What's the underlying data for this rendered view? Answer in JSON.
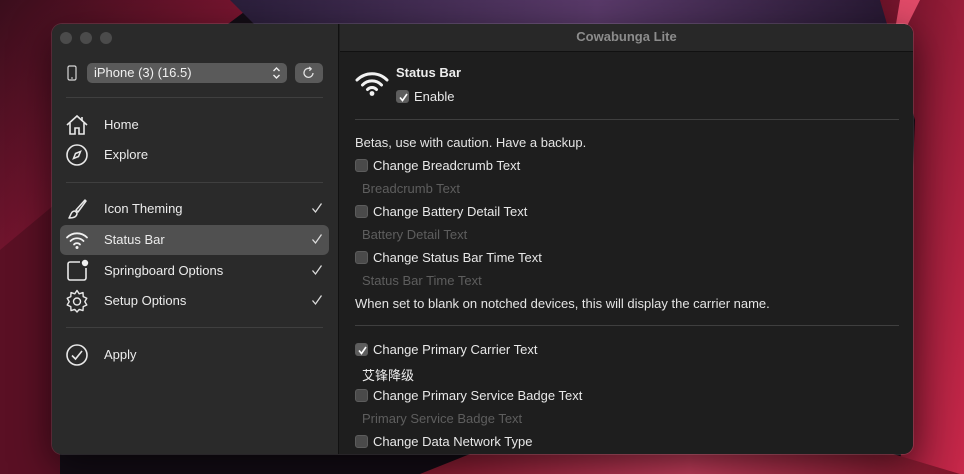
{
  "window": {
    "title": "Cowabunga Lite"
  },
  "sidebar": {
    "device_select": "iPhone (3) (16.5)",
    "items": [
      {
        "label": "Home",
        "icon": "house-icon",
        "checked": false
      },
      {
        "label": "Explore",
        "icon": "compass-icon",
        "checked": false
      },
      {
        "label": "Icon Theming",
        "icon": "paintbrush-icon",
        "checked": true
      },
      {
        "label": "Status Bar",
        "icon": "wifi-icon",
        "checked": true,
        "selected": true
      },
      {
        "label": "Springboard Options",
        "icon": "app-badge-icon",
        "checked": true
      },
      {
        "label": "Setup Options",
        "icon": "gear-icon",
        "checked": true
      },
      {
        "label": "Apply",
        "icon": "checkmark-circle-icon",
        "checked": false
      }
    ]
  },
  "content": {
    "section_title": "Status Bar",
    "enable_label": "Enable",
    "enable_checked": true,
    "beta_note": "Betas, use with caution. Have a backup.",
    "breadcrumb_label": "Change Breadcrumb Text",
    "breadcrumb_placeholder": "Breadcrumb Text",
    "battery_label": "Change Battery Detail Text",
    "battery_placeholder": "Battery Detail Text",
    "time_label": "Change Status Bar Time Text",
    "time_placeholder": "Status Bar Time Text",
    "carrier_note": "When set to blank on notched devices, this will display the carrier name.",
    "primary_carrier_label": "Change Primary Carrier Text",
    "primary_carrier_checked": true,
    "primary_carrier_value": "艾锋降级",
    "service_badge_label": "Change Primary Service Badge Text",
    "service_badge_placeholder": "Primary Service Badge Text",
    "data_network_label": "Change Data Network Type"
  },
  "colors": {
    "window_bg": "#1e1e1e",
    "sidebar_bg": "#2a2a2a",
    "selected_bg": "#505050",
    "placeholder_text": "#5e5e5e"
  }
}
